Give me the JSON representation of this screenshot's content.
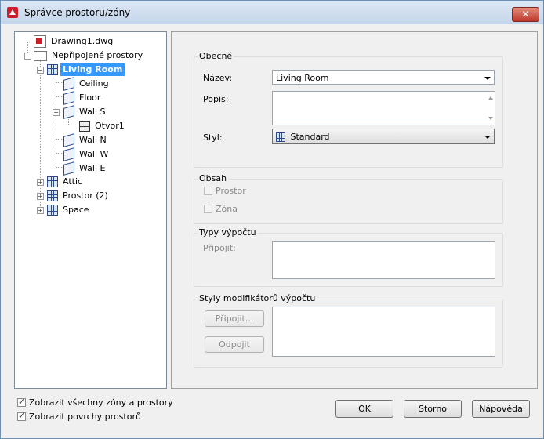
{
  "window": {
    "title": "Správce prostoru/zóny",
    "close_label": "✕"
  },
  "tree": {
    "items": [
      {
        "label": "Drawing1.dwg",
        "icon": "dwg-file-icon"
      },
      {
        "label": "Nepřipojené prostory",
        "icon": "folder-icon"
      },
      {
        "label": "Living Room",
        "icon": "space-icon",
        "selected": true
      },
      {
        "label": "Ceiling",
        "icon": "surface-icon"
      },
      {
        "label": "Floor",
        "icon": "surface-icon"
      },
      {
        "label": "Wall S",
        "icon": "surface-icon"
      },
      {
        "label": "Otvor1",
        "icon": "opening-icon"
      },
      {
        "label": "Wall N",
        "icon": "surface-icon"
      },
      {
        "label": "Wall W",
        "icon": "surface-icon"
      },
      {
        "label": "Wall E",
        "icon": "surface-icon"
      },
      {
        "label": "Attic",
        "icon": "space-icon"
      },
      {
        "label": "Prostor (2)",
        "icon": "space-icon"
      },
      {
        "label": "Space",
        "icon": "space-icon"
      }
    ]
  },
  "general": {
    "title": "Obecné",
    "name_label": "Název:",
    "name_value": "Living Room",
    "description_label": "Popis:",
    "style_label": "Styl:",
    "style_value": "Standard"
  },
  "contents": {
    "title": "Obsah",
    "space_label": "Prostor",
    "zone_label": "Zóna"
  },
  "calc_types": {
    "title": "Typy výpočtu",
    "attach_label": "Připojit:"
  },
  "calc_modifiers": {
    "title": "Styly modifikátorů výpočtu",
    "attach_button": "Připojit...",
    "detach_button": "Odpojit"
  },
  "options": {
    "show_all_zones": "Zobrazit všechny zóny a prostory",
    "show_space_surfaces": "Zobrazit povrchy prostorů"
  },
  "buttons": {
    "ok": "OK",
    "cancel": "Storno",
    "help": "Nápověda"
  }
}
